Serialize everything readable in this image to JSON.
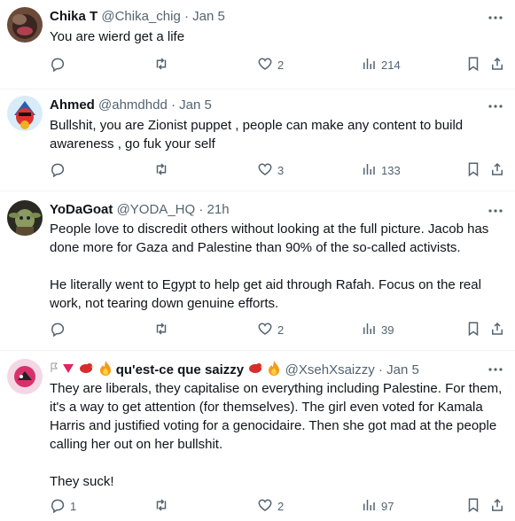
{
  "tweets": [
    {
      "name": "Chika T",
      "handle": "@Chika_chig",
      "sep": "·",
      "time": "Jan 5",
      "text": "You are wierd get a life",
      "replies": "",
      "likes": "2",
      "views": "214"
    },
    {
      "name": "Ahmed",
      "handle": "@ahmdhdd",
      "sep": "·",
      "time": "Jan 5",
      "text": "Bullshit, you are Zionist puppet , people can make any content to build awareness , go fuk your self",
      "replies": "",
      "likes": "3",
      "views": "133"
    },
    {
      "name": "YoDaGoat",
      "handle": "@YODA_HQ",
      "sep": "·",
      "time": "21h",
      "text": "People love to discredit others without looking at the full picture. Jacob has done more for Gaza and Palestine than 90% of the so-called activists.\n\nHe literally went to Egypt to help get aid through Rafah. Focus on the real work, not tearing down genuine efforts.",
      "replies": "",
      "likes": "2",
      "views": "39"
    },
    {
      "name": "qu'est-ce que saizzy",
      "handle": "@XsehXsaizzy",
      "sep": "·",
      "time": "Jan 5",
      "text": "They are liberals, they capitalise on everything including Palestine. For them, it's a way to get attention (for themselves). The girl even voted for Kamala Harris and justified voting for a genocidaire. Then she got mad at the people calling her out on her bullshit.\n\nThey suck!",
      "replies": "1",
      "likes": "2",
      "views": "97"
    }
  ]
}
